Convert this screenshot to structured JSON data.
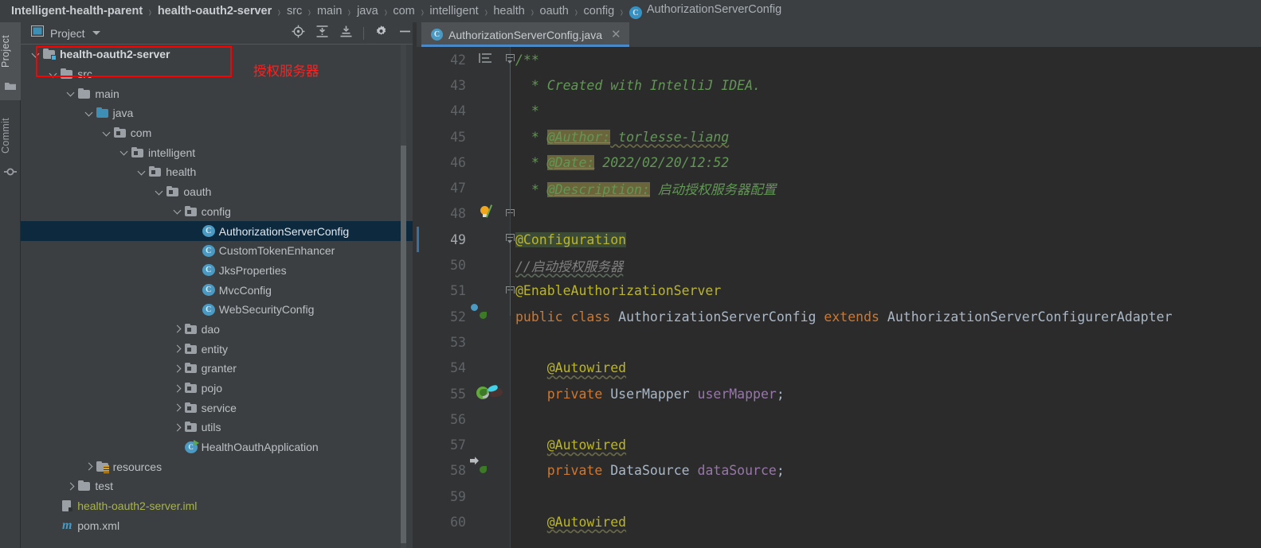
{
  "breadcrumb": {
    "separator": "›",
    "items": [
      {
        "label": "Intelligent-health-parent",
        "bold": true
      },
      {
        "label": "health-oauth2-server",
        "bold": true
      },
      {
        "label": "src",
        "bold": false
      },
      {
        "label": "main",
        "bold": false
      },
      {
        "label": "java",
        "bold": false
      },
      {
        "label": "com",
        "bold": false
      },
      {
        "label": "intelligent",
        "bold": false
      },
      {
        "label": "health",
        "bold": false
      },
      {
        "label": "oauth",
        "bold": false
      },
      {
        "label": "config",
        "bold": false
      },
      {
        "label": "AuthorizationServerConfig",
        "bold": false,
        "icon": "class-icon",
        "icon_letter": "C"
      }
    ]
  },
  "tool_strip": {
    "items": [
      {
        "label": "Project",
        "icon": "folder-icon",
        "active": true
      },
      {
        "label": "Commit",
        "icon": "commit-icon",
        "active": false
      }
    ]
  },
  "project_panel": {
    "title": "Project",
    "dropdown_icon": "chevron-down-icon",
    "toolbar": [
      {
        "name": "select-opened-file-icon",
        "glyph": "target"
      },
      {
        "name": "expand-all-icon",
        "glyph": "expand"
      },
      {
        "name": "collapse-all-icon",
        "glyph": "collapse"
      },
      {
        "name": "settings-gear-icon",
        "glyph": "gear"
      },
      {
        "name": "hide-panel-icon",
        "glyph": "minus"
      }
    ],
    "tree": [
      {
        "label": "health-oauth2-server",
        "indent": 0,
        "arrow": "down",
        "icon": "module-folder-icon",
        "bold": true
      },
      {
        "label": "src",
        "indent": 1,
        "arrow": "down",
        "icon": "folder-icon"
      },
      {
        "label": "main",
        "indent": 2,
        "arrow": "down",
        "icon": "folder-icon"
      },
      {
        "label": "java",
        "indent": 3,
        "arrow": "down",
        "icon": "source-folder-icon"
      },
      {
        "label": "com",
        "indent": 4,
        "arrow": "down",
        "icon": "package-icon"
      },
      {
        "label": "intelligent",
        "indent": 5,
        "arrow": "down",
        "icon": "package-icon"
      },
      {
        "label": "health",
        "indent": 6,
        "arrow": "down",
        "icon": "package-icon"
      },
      {
        "label": "oauth",
        "indent": 7,
        "arrow": "down",
        "icon": "package-icon"
      },
      {
        "label": "config",
        "indent": 8,
        "arrow": "down",
        "icon": "package-icon"
      },
      {
        "label": "AuthorizationServerConfig",
        "indent": 9,
        "arrow": "none",
        "icon": "java-class-icon",
        "selected": true
      },
      {
        "label": "CustomTokenEnhancer",
        "indent": 9,
        "arrow": "none",
        "icon": "java-class-icon"
      },
      {
        "label": "JksProperties",
        "indent": 9,
        "arrow": "none",
        "icon": "java-class-icon"
      },
      {
        "label": "MvcConfig",
        "indent": 9,
        "arrow": "none",
        "icon": "java-class-icon"
      },
      {
        "label": "WebSecurityConfig",
        "indent": 9,
        "arrow": "none",
        "icon": "java-class-icon"
      },
      {
        "label": "dao",
        "indent": 8,
        "arrow": "right",
        "icon": "package-icon"
      },
      {
        "label": "entity",
        "indent": 8,
        "arrow": "right",
        "icon": "package-icon"
      },
      {
        "label": "granter",
        "indent": 8,
        "arrow": "right",
        "icon": "package-icon"
      },
      {
        "label": "pojo",
        "indent": 8,
        "arrow": "right",
        "icon": "package-icon"
      },
      {
        "label": "service",
        "indent": 8,
        "arrow": "right",
        "icon": "package-icon"
      },
      {
        "label": "utils",
        "indent": 8,
        "arrow": "right",
        "icon": "package-icon"
      },
      {
        "label": "HealthOauthApplication",
        "indent": 8,
        "arrow": "none",
        "icon": "spring-boot-class-icon"
      },
      {
        "label": "resources",
        "indent": 3,
        "arrow": "right",
        "icon": "resources-folder-icon"
      },
      {
        "label": "test",
        "indent": 2,
        "arrow": "right",
        "icon": "folder-icon"
      },
      {
        "label": "health-oauth2-server.iml",
        "indent": 1,
        "arrow": "none",
        "icon": "iml-file-icon",
        "color": "olive"
      },
      {
        "label": "pom.xml",
        "indent": 1,
        "arrow": "none",
        "icon": "maven-icon",
        "icon_letter": "m"
      }
    ]
  },
  "annotation": {
    "box_color": "#ff0000",
    "text": "授权服务器",
    "text_color": "#ff2020"
  },
  "editor": {
    "tab": {
      "label": "AuthorizationServerConfig.java",
      "icon": "java-class-icon",
      "icon_letter": "C",
      "close_icon": "close-icon",
      "active": true,
      "accent_color": "#4a88c7"
    },
    "lines": [
      {
        "num": "42",
        "fold": "start-open",
        "gutter_icon": "align-icon",
        "current": false,
        "segments": [
          {
            "t": "/**",
            "c": "cmt"
          }
        ]
      },
      {
        "num": "43",
        "current": false,
        "segments": [
          {
            "t": "  * Created with IntelliJ IDEA.",
            "c": "cmt"
          }
        ]
      },
      {
        "num": "44",
        "current": false,
        "segments": [
          {
            "t": "  *",
            "c": "cmt"
          }
        ]
      },
      {
        "num": "45",
        "current": false,
        "segments": [
          {
            "t": "  * ",
            "c": "cmt"
          },
          {
            "t": "@Author:",
            "c": "jd-tag"
          },
          {
            "t": " torlesse-liang",
            "c": "cmt squiggle"
          }
        ]
      },
      {
        "num": "46",
        "current": false,
        "segments": [
          {
            "t": "  * ",
            "c": "cmt"
          },
          {
            "t": "@Date:",
            "c": "jd-tag"
          },
          {
            "t": " 2022/02/20/12:52",
            "c": "cmt"
          }
        ]
      },
      {
        "num": "47",
        "current": false,
        "segments": [
          {
            "t": "  * ",
            "c": "cmt"
          },
          {
            "t": "@Description:",
            "c": "jd-tag"
          },
          {
            "t": " 启动授权服务器配置",
            "c": "cmt"
          }
        ]
      },
      {
        "num": "48",
        "fold": "cap",
        "gutter_icon": "intention-bulb-icon",
        "current": false,
        "segments": [
          {
            "t": "  ",
            "c": "cmt"
          }
        ]
      },
      {
        "num": "49",
        "fold": "start-open",
        "current": true,
        "segments": [
          {
            "t": "@Configuration",
            "c": "ann hl-cfg"
          }
        ]
      },
      {
        "num": "50",
        "current": false,
        "segments": [
          {
            "t": "//启动授权服务器",
            "c": "cmt-plain squiggle-g"
          }
        ]
      },
      {
        "num": "51",
        "fold": "cap",
        "current": false,
        "segments": [
          {
            "t": "@EnableAuthorizationServer",
            "c": "ann"
          }
        ]
      },
      {
        "num": "52",
        "gutter_icon": "spring-bean-icon",
        "current": false,
        "segments": [
          {
            "t": "public class ",
            "c": "kw"
          },
          {
            "t": "AuthorizationServerConfig ",
            "c": "type"
          },
          {
            "t": "extends ",
            "c": "kw"
          },
          {
            "t": "AuthorizationServerConfigurerAdapter",
            "c": "type"
          }
        ]
      },
      {
        "num": "53",
        "current": false,
        "segments": []
      },
      {
        "num": "54",
        "current": false,
        "segments": [
          {
            "t": "    ",
            "c": ""
          },
          {
            "t": "@Autowired",
            "c": "ann squiggle"
          }
        ]
      },
      {
        "num": "55",
        "gutter_icon": "spring-autowired-mybatis-icon",
        "current": false,
        "segments": [
          {
            "t": "    ",
            "c": ""
          },
          {
            "t": "private ",
            "c": "kw"
          },
          {
            "t": "UserMapper ",
            "c": "type"
          },
          {
            "t": "userMapper",
            "c": "field"
          },
          {
            "t": ";",
            "c": "type"
          }
        ]
      },
      {
        "num": "56",
        "current": false,
        "segments": []
      },
      {
        "num": "57",
        "current": false,
        "segments": [
          {
            "t": "    ",
            "c": ""
          },
          {
            "t": "@Autowired",
            "c": "ann squiggle"
          }
        ]
      },
      {
        "num": "58",
        "gutter_icon": "spring-autowired-icon",
        "current": false,
        "segments": [
          {
            "t": "    ",
            "c": ""
          },
          {
            "t": "private ",
            "c": "kw"
          },
          {
            "t": "DataSource ",
            "c": "type"
          },
          {
            "t": "dataSource",
            "c": "field"
          },
          {
            "t": ";",
            "c": "type"
          }
        ]
      },
      {
        "num": "59",
        "current": false,
        "segments": []
      },
      {
        "num": "60",
        "current": false,
        "segments": [
          {
            "t": "    ",
            "c": ""
          },
          {
            "t": "@Autowired",
            "c": "ann squiggle"
          }
        ]
      }
    ]
  },
  "colors": {
    "editor_bg": "#2b2b2b",
    "panel_bg": "#3c3f41",
    "gutter_bg": "#313335",
    "selection_bg": "#0d293e",
    "accent": "#4a88c7"
  }
}
